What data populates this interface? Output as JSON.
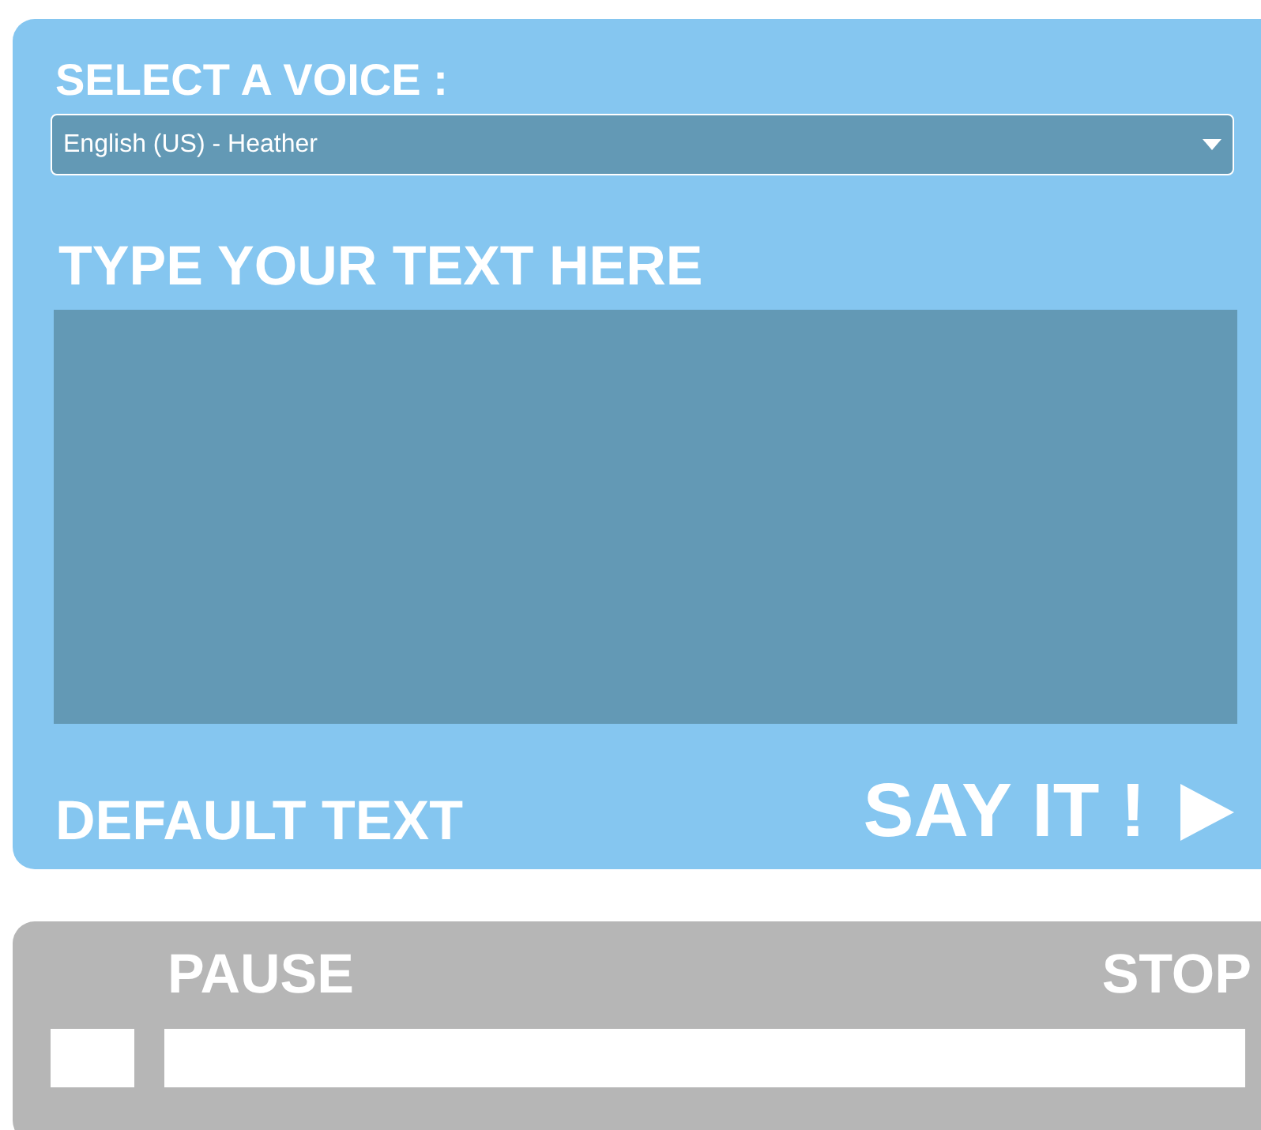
{
  "voice_section": {
    "label": "SELECT A VOICE :",
    "selected_voice": "English (US) - Heather"
  },
  "text_section": {
    "label": "TYPE YOUR TEXT HERE"
  },
  "actions": {
    "default_text": "DEFAULT TEXT",
    "say_it": "SAY IT !"
  },
  "player": {
    "pause": "PAUSE",
    "stop": "STOP",
    "progress": {
      "level": 0
    }
  }
}
